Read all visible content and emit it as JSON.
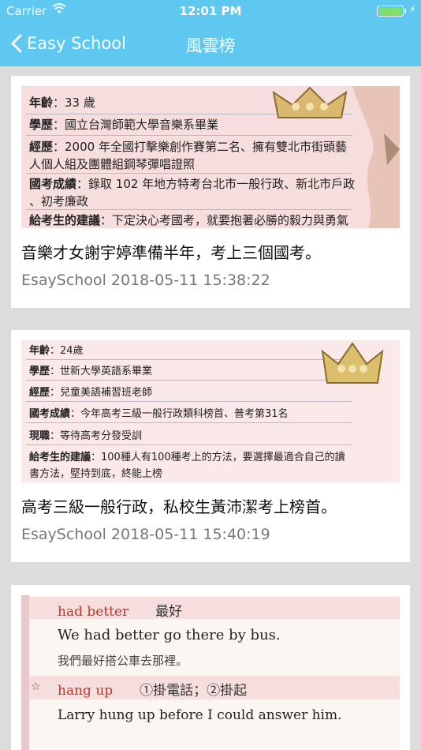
{
  "status_bar": {
    "carrier": "Carrier",
    "time": "12:01 PM"
  },
  "nav": {
    "back_label": "Easy School",
    "title": "風雲榜"
  },
  "articles": [
    {
      "title": "音樂才女謝宇婷準備半年，考上三個國考。",
      "meta": "EsaySchool 2018-05-11 15:38:22",
      "image_lines": [
        {
          "label": "年齡",
          "text": "：33 歲"
        },
        {
          "label": "學歷",
          "text": "：國立台灣師範大學音樂系畢業"
        },
        {
          "label": "經歷",
          "text": "：2000 年全國打擊樂創作賽第二名、擁有雙北市街頭藝"
        },
        {
          "label": "",
          "text": "人個人組及團體組鋼琴彈唱證照"
        },
        {
          "label": "國考成績",
          "text": "：錄取 102 年地方特考台北市一般行政、新北市戶政"
        },
        {
          "label": "",
          "text": "、初考廉政"
        },
        {
          "label": "給考生的建議",
          "text": "：下定決心考國考，就要抱著必勝的毅力與勇氣"
        }
      ]
    },
    {
      "title": "高考三級一般行政，私校生黃沛潔考上榜首。",
      "meta": "EsaySchool 2018-05-11 15:40:19",
      "image_lines": [
        {
          "label": "年齡",
          "text": "：24歲"
        },
        {
          "label": "學歷",
          "text": "：世新大學英語系畢業"
        },
        {
          "label": "經歷",
          "text": "：兒童美語補習班老師"
        },
        {
          "label": "國考成績",
          "text": "：今年高考三級一般行政類科榜首、普考第31名"
        },
        {
          "label": "現職",
          "text": "：等待高考分發受訓"
        },
        {
          "label": "給考生的建議",
          "text": "：100種人有100種考上的方法，要選擇最適合自己的讀"
        },
        {
          "label": "",
          "text": "書方法，堅持到底，終能上榜"
        }
      ]
    },
    {
      "image_lines": [
        {
          "label": "had better",
          "text": "最好"
        },
        {
          "label": "",
          "text": "We had better go there by bus."
        },
        {
          "label": "",
          "text": "我們最好搭公車去那裡。"
        },
        {
          "label": "hang up",
          "text": "①掛電話；②掛起"
        },
        {
          "label": "",
          "text": "Larry hung up before I could answer him."
        }
      ]
    }
  ],
  "colors": {
    "nav_bg": "#5ec8f0",
    "page_bg": "#dcdcdc",
    "meta_text": "#777777"
  }
}
